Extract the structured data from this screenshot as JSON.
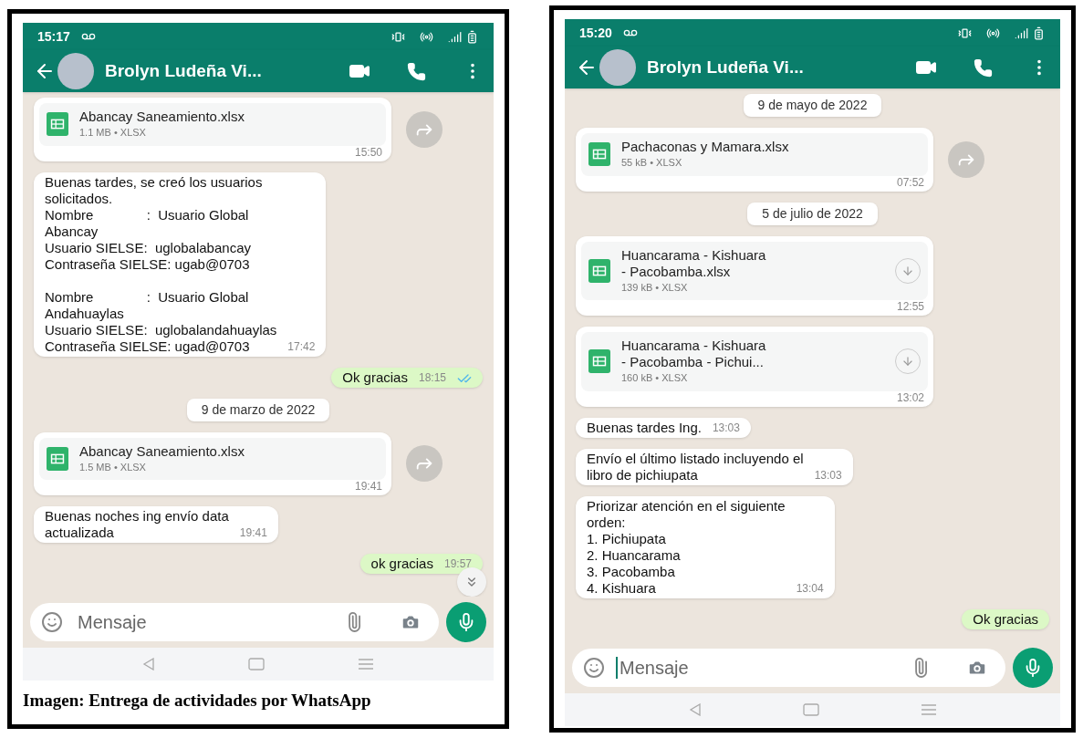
{
  "phones": [
    {
      "status_time": "15:17",
      "contact": "Brolyn Ludeña Vi...",
      "input_placeholder": "Mensaje",
      "scroll_button": true,
      "caption": "Imagen: Entrega de actividades por WhatsApp",
      "messages": [
        {
          "kind": "file",
          "outgoing": false,
          "name": "Abancay Saneamiento.xlsx",
          "meta": "1.1 MB • XLSX",
          "time": "15:50",
          "downloaded": true
        },
        {
          "kind": "text",
          "outgoing": false,
          "text": "Buenas tardes, se creó los usuarios\nsolicitados.\nNombre              :  Usuario Global\nAbancay\nUsuario SIELSE:  uglobalabancay\nContraseña SIELSE: ugab@0703\n\nNombre              :  Usuario Global\nAndahuaylas\nUsuario SIELSE:  uglobalandahuaylas\nContraseña SIELSE: ugad@0703",
          "time": "17:42"
        },
        {
          "kind": "text",
          "outgoing": true,
          "text": "Ok gracias",
          "time": "18:15",
          "read": true
        },
        {
          "kind": "date",
          "text": "9 de marzo de 2022"
        },
        {
          "kind": "file",
          "outgoing": false,
          "name": "Abancay Saneamiento.xlsx",
          "meta": "1.5 MB • XLSX",
          "time": "19:41",
          "downloaded": true
        },
        {
          "kind": "text",
          "outgoing": false,
          "text": "Buenas noches ing envío data\nactualizada",
          "time": "19:41"
        },
        {
          "kind": "text",
          "outgoing": true,
          "text": "ok gracias",
          "time": "19:57"
        }
      ]
    },
    {
      "status_time": "15:20",
      "contact": "Brolyn Ludeña Vi...",
      "input_placeholder": "Mensaje",
      "input_focused": true,
      "scroll_button": false,
      "messages": [
        {
          "kind": "date",
          "text": "9 de mayo de 2022"
        },
        {
          "kind": "file",
          "outgoing": false,
          "name": "Pachaconas y Mamara.xlsx",
          "meta": "55 kB • XLSX",
          "time": "07:52",
          "downloaded": true
        },
        {
          "kind": "date",
          "text": "5 de julio de 2022"
        },
        {
          "kind": "file",
          "outgoing": false,
          "name": "Huancarama - Kishuara\n- Pacobamba.xlsx",
          "meta": "139 kB • XLSX",
          "time": "12:55",
          "downloaded": false
        },
        {
          "kind": "file",
          "outgoing": false,
          "name": "Huancarama - Kishuara\n- Pacobamba - Pichui...",
          "meta": "160 kB • XLSX",
          "time": "13:02",
          "downloaded": false
        },
        {
          "kind": "text",
          "outgoing": false,
          "text": "Buenas tardes Ing.",
          "time": "13:03"
        },
        {
          "kind": "text",
          "outgoing": false,
          "text": "Envío el último listado incluyendo el\nlibro de pichiupata",
          "time": "13:03"
        },
        {
          "kind": "text",
          "outgoing": false,
          "text": "Priorizar atención en el siguiente\norden:\n1. Pichiupata\n2. Huancarama\n3. Pacobamba\n4. Kishuara",
          "time": "13:04"
        },
        {
          "kind": "text",
          "outgoing": true,
          "text": "Ok gracias"
        }
      ]
    }
  ]
}
